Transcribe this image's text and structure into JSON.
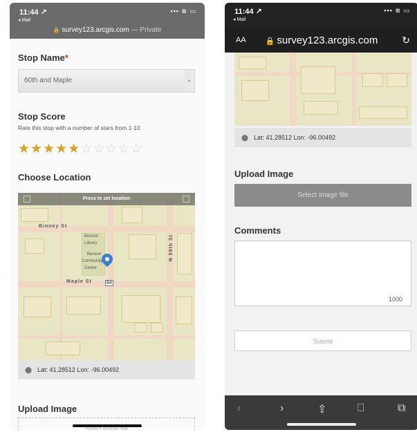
{
  "left_screen": {
    "status": {
      "time": "11:44 ↗",
      "back_app": "◂ Mail",
      "signal": "▪▪▪ ≋ ▭"
    },
    "address": {
      "url": "survey123.arcgis.com",
      "suffix": "— Private"
    },
    "stop_name": {
      "label": "Stop Name",
      "required_mark": "*",
      "value": "60th and Maple"
    },
    "stop_score": {
      "label": "Stop Score",
      "hint": "Rate this stop with a number of stars from 1-10",
      "rating": 5,
      "max": 10
    },
    "location": {
      "label": "Choose Location",
      "map_header": "Press to set location",
      "streets": [
        "Binney St",
        "Maple St",
        "N 59th St"
      ],
      "places": [
        "Benson",
        "Library",
        "Benson",
        "Community",
        "Center"
      ],
      "shield": "64",
      "coords": "Lat: 41.28512  Lon: -96.00492"
    },
    "upload": {
      "label": "Upload Image",
      "button": "Select image file"
    }
  },
  "right_screen": {
    "status": {
      "time": "11:44 ↗",
      "back_app": "◂ Mail",
      "signal": "▪▪▪ ≋ ▭"
    },
    "address": {
      "aa": "AA",
      "url": "survey123.arcgis.com",
      "reload": "↻"
    },
    "coords": "Lat: 41.28512  Lon: -96.00492",
    "upload": {
      "label": "Upload Image",
      "button": "Select image file"
    },
    "comments": {
      "label": "Comments",
      "counter": "1000"
    },
    "submit": "Submit",
    "toolbar": {
      "back": "‹",
      "forward": "›",
      "share": "⇪",
      "bookmarks": "⎕",
      "tabs": "⧉"
    }
  },
  "colors": {
    "star": "#d7a322",
    "pin": "#3d7fd1",
    "required": "#c0392b"
  }
}
